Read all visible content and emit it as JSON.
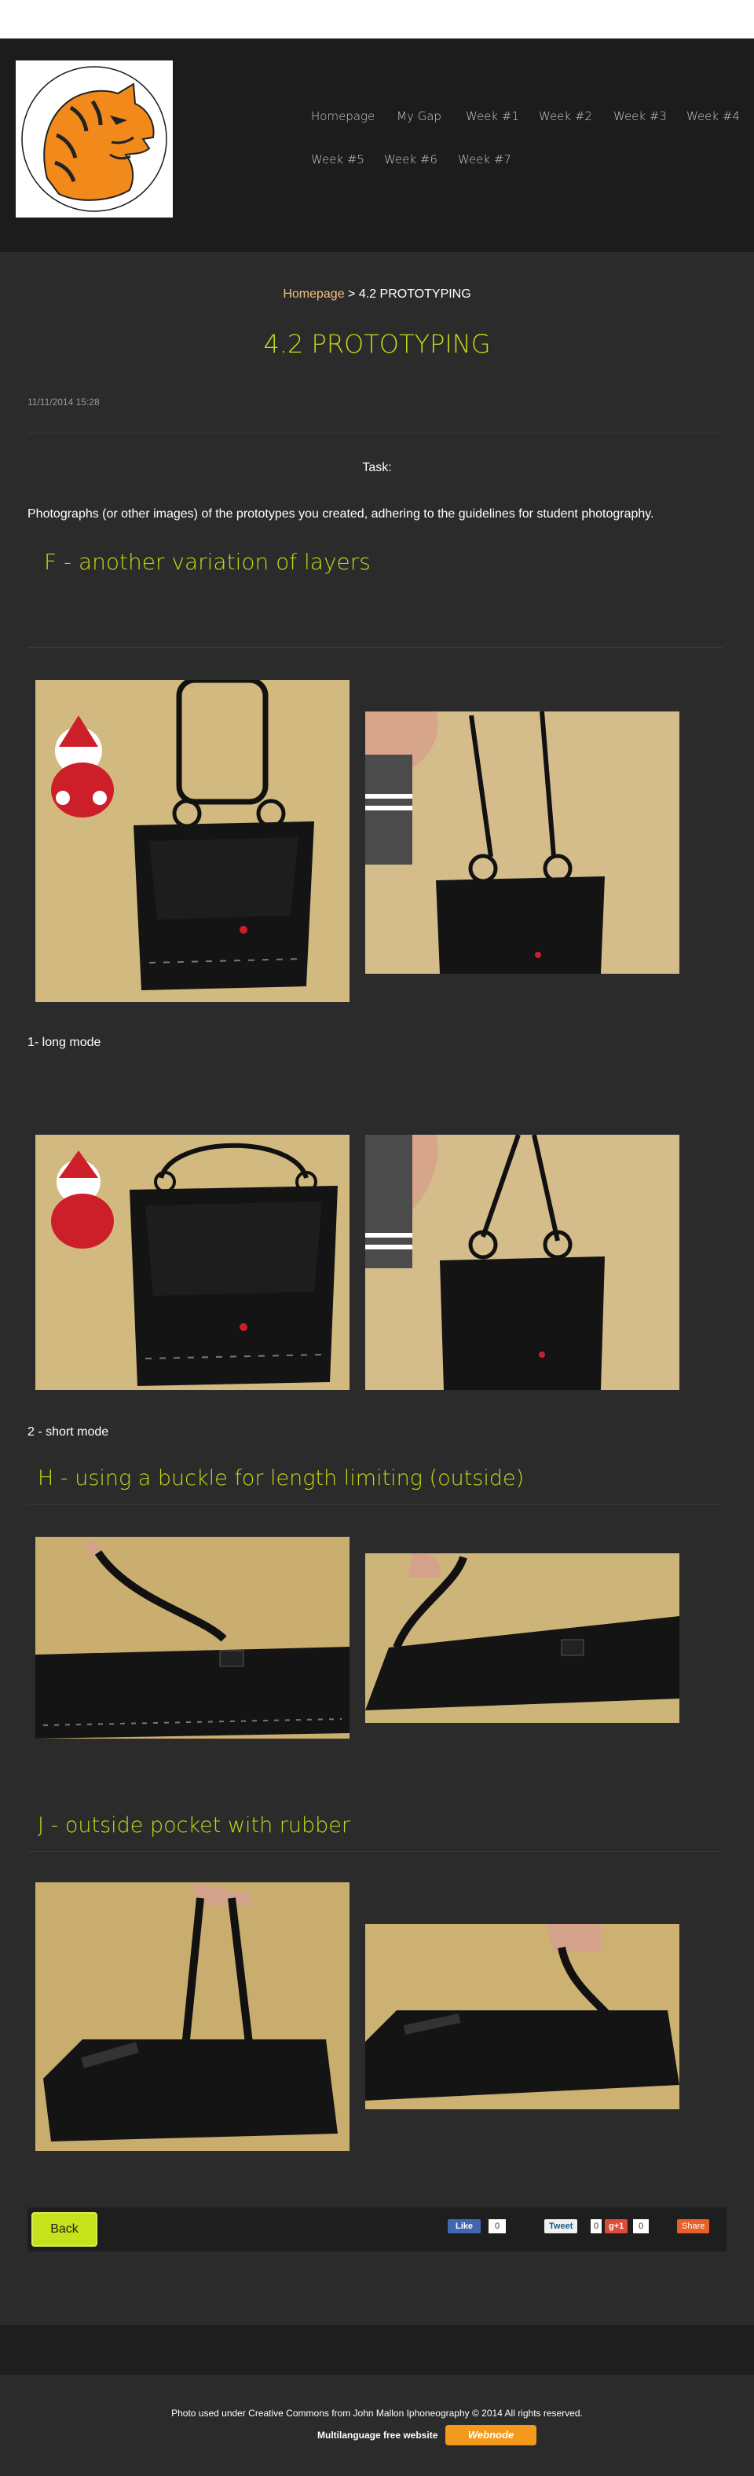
{
  "nav": {
    "items": [
      "Homepage",
      "My Gap",
      "Week #1",
      "Week #2",
      "Week #3",
      "Week #4",
      "Week #5",
      "Week #6",
      "Week #7"
    ]
  },
  "breadcrumb": {
    "home": "Homepage",
    "separator": " > ",
    "current": "4.2 PROTOTYPING"
  },
  "page": {
    "title": "4.2 PROTOTYPING",
    "date": "11/11/2014 15:28",
    "task_label": "Task:",
    "description": "Photographs (or other images) of the prototypes you created, adhering to the guidelines for student photography."
  },
  "sections": {
    "f_title": "F - another variation of layers",
    "caption_long": "1- long mode",
    "caption_short": "2 - short mode",
    "h_title": "H - using a buckle  for length limiting  (outside)",
    "j_title": "J -  outside pocket with rubber"
  },
  "actions": {
    "back_label": "Back"
  },
  "social": {
    "fb_like": "Like",
    "fb_count": "0",
    "tweet": "Tweet",
    "tweet_count": "0",
    "gplus": "g+1",
    "gplus_count": "0",
    "share": "Share"
  },
  "footer": {
    "credit": "Photo used under Creative Commons from John Mallon Iphoneography  © 2014 All rights reserved.",
    "multilanguage": "Multilanguage free website",
    "webnode": "Webnode"
  },
  "colors": {
    "accent_green": "#c6d918",
    "breadcrumb_link": "#f6c07c",
    "background": "#2b2b2b",
    "header_bg": "#1c1c1c"
  }
}
